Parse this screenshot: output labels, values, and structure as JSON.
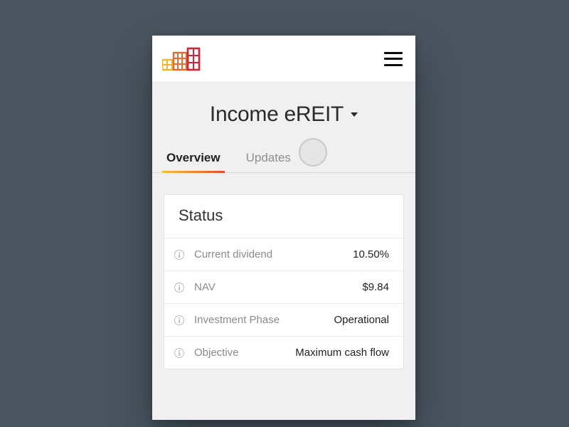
{
  "header": {
    "logo_name": "buildings-logo"
  },
  "title": {
    "text": "Income eREIT"
  },
  "tabs": [
    {
      "label": "Overview",
      "active": true
    },
    {
      "label": "Updates",
      "active": false
    }
  ],
  "status_card": {
    "heading": "Status",
    "rows": [
      {
        "label": "Current dividend",
        "value": "10.50%"
      },
      {
        "label": "NAV",
        "value": "$9.84"
      },
      {
        "label": "Investment Phase",
        "value": "Operational"
      },
      {
        "label": "Objective",
        "value": "Maximum cash flow"
      }
    ]
  }
}
